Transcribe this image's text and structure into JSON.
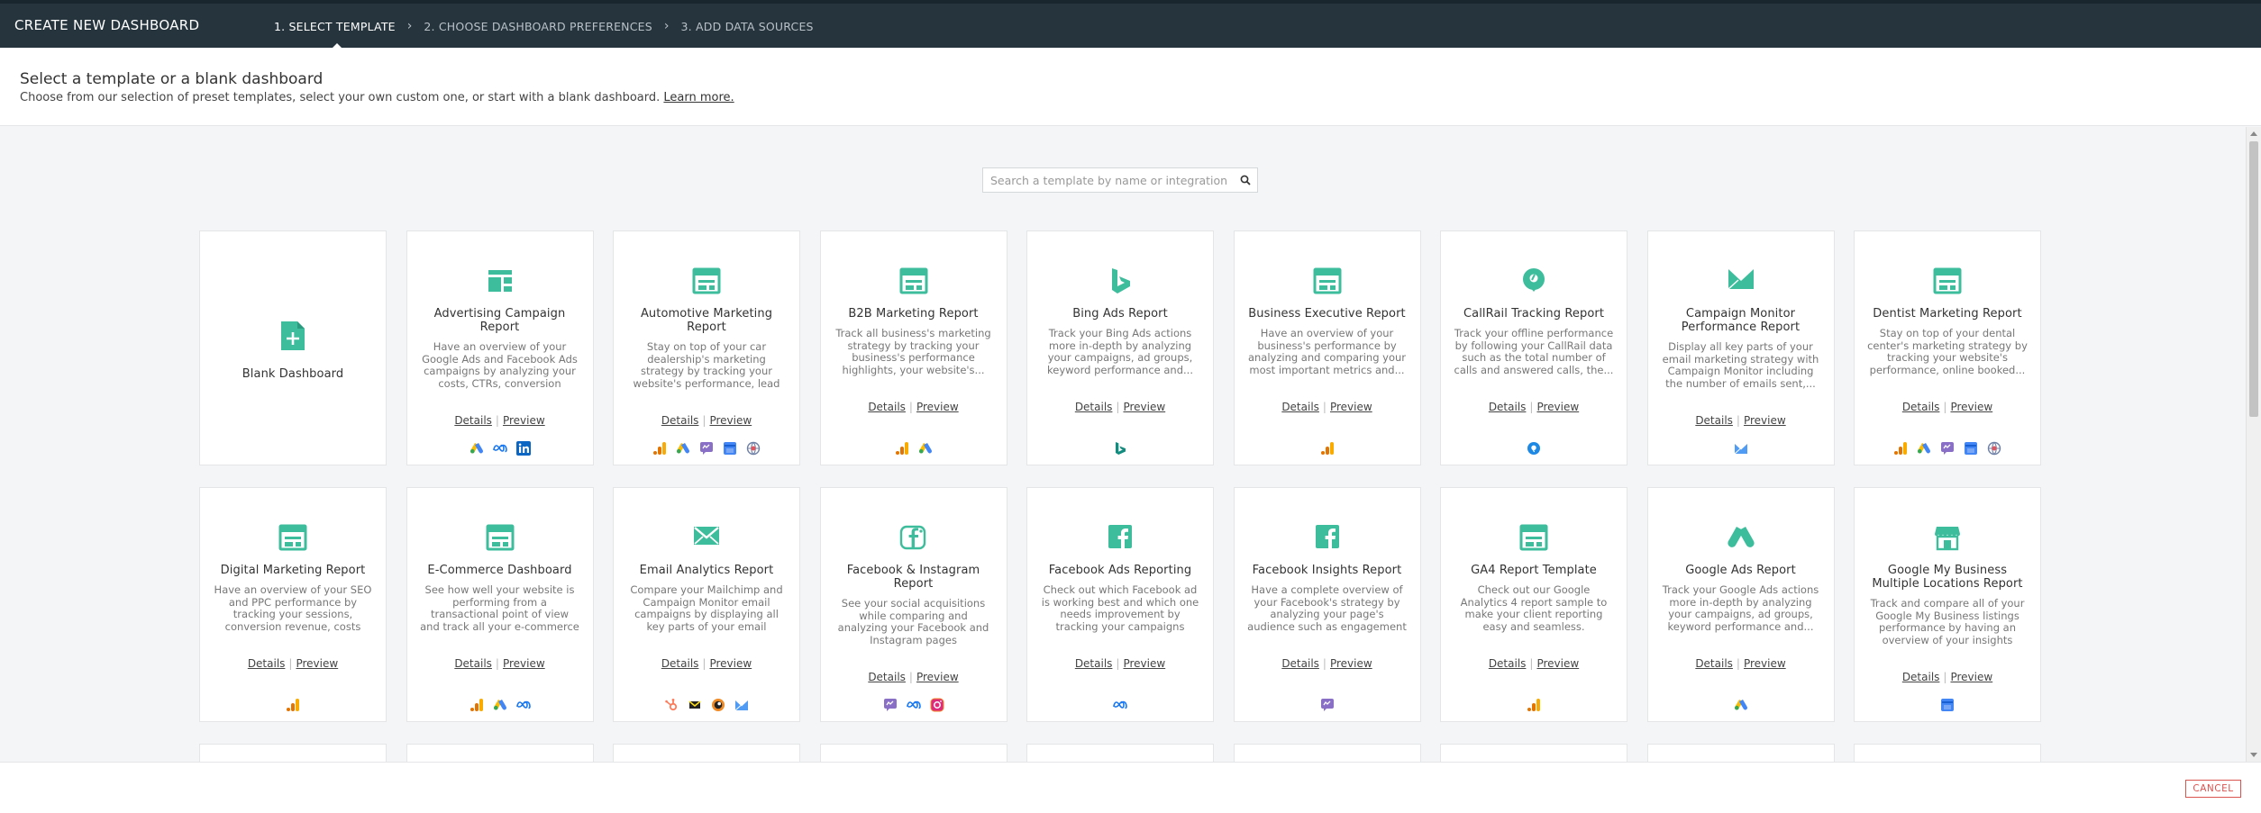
{
  "header": {
    "title": "CREATE NEW DASHBOARD",
    "steps": [
      "1. SELECT TEMPLATE",
      "2. CHOOSE DASHBOARD PREFERENCES",
      "3. ADD DATA SOURCES"
    ]
  },
  "intro": {
    "heading": "Select a template or a blank dashboard",
    "text": "Choose from our selection of preset templates, select your own custom one, or start with a blank dashboard.",
    "learn_more": "Learn more."
  },
  "search": {
    "placeholder": "Search a template by name or integration..."
  },
  "links": {
    "details": "Details",
    "preview": "Preview"
  },
  "blank_label": "Blank Dashboard",
  "templates": [
    {
      "name": "Advertising Campaign Report",
      "desc": "Have an overview of your Google Ads and Facebook Ads campaigns by analyzing your costs, CTRs, conversion rates...",
      "icon": "dashboard-icon",
      "integrations": [
        "google-ads-icon",
        "meta-icon",
        "linkedin-icon"
      ]
    },
    {
      "name": "Automotive Marketing Report",
      "desc": "Stay on top of your car dealership's marketing strategy by tracking your website's performance, lead acquisition...",
      "icon": "template-icon",
      "integrations": [
        "google-analytics-icon",
        "google-ads-icon",
        "chat-icon",
        "gmb-icon",
        "globe-icon"
      ]
    },
    {
      "name": "B2B Marketing Report",
      "desc": "Track all business's marketing strategy by tracking your business's performance highlights, your website's...",
      "icon": "template-icon",
      "integrations": [
        "google-analytics-icon",
        "google-ads-icon"
      ]
    },
    {
      "name": "Bing Ads Report",
      "desc": "Track your Bing Ads actions more in-depth by analyzing your campaigns, ad groups, keyword performance and...",
      "icon": "bing-icon",
      "integrations": [
        "bing-icon"
      ]
    },
    {
      "name": "Business Executive Report",
      "desc": "Have an overview of your business's performance by analyzing and comparing your most important metrics and...",
      "icon": "template-icon",
      "integrations": [
        "google-analytics-icon"
      ]
    },
    {
      "name": "CallRail Tracking Report",
      "desc": "Track your offline performance by following your CallRail data such as the total number of calls and answered calls, the...",
      "icon": "callrail-icon",
      "integrations": [
        "callrail-icon"
      ]
    },
    {
      "name": "Campaign Monitor Performance Report",
      "desc": "Display all key parts of your email marketing strategy with Campaign Monitor including the number of emails sent,...",
      "icon": "campaign-monitor-icon",
      "integrations": [
        "campaign-monitor-icon"
      ]
    },
    {
      "name": "Dentist Marketing Report",
      "desc": "Stay on top of your dental center's marketing strategy by tracking your website's performance, online booked...",
      "icon": "template-icon",
      "integrations": [
        "google-analytics-icon",
        "google-ads-icon",
        "chat-icon",
        "gmb-icon",
        "globe-icon"
      ]
    },
    {
      "name": "Digital Marketing Report",
      "desc": "Have an overview of your SEO and PPC performance by tracking your sessions, conversion revenue, costs and...",
      "icon": "template-icon",
      "integrations": [
        "google-analytics-icon"
      ]
    },
    {
      "name": "E-Commerce Dashboard",
      "desc": "See how well your website is performing from a transactional point of view and track all your e-commerce dat...",
      "icon": "template-icon",
      "integrations": [
        "google-analytics-icon",
        "google-ads-icon",
        "meta-icon"
      ]
    },
    {
      "name": "Email Analytics Report",
      "desc": "Compare your Mailchimp and Campaign Monitor email campaigns by displaying all key parts of your email marketing...",
      "icon": "email-icon",
      "integrations": [
        "hubspot-icon",
        "mailchimp-icon",
        "circle-icon",
        "campaign-monitor-icon"
      ]
    },
    {
      "name": "Facebook & Instagram Report",
      "desc": "See your social acquisitions while comparing and analyzing your Facebook and Instagram pages performances such as...",
      "icon": "facebook-instagram-icon",
      "integrations": [
        "chat-icon",
        "meta-icon",
        "instagram-icon"
      ]
    },
    {
      "name": "Facebook Ads Reporting",
      "desc": "Check out which Facebook ad is working best and which one needs improvement by tracking your campaigns performance...",
      "icon": "facebook-icon",
      "integrations": [
        "meta-icon"
      ]
    },
    {
      "name": "Facebook Insights Report",
      "desc": "Have a complete overview of your Facebook's strategy by analyzing your page's audience such as engagement rates,...",
      "icon": "facebook-icon",
      "integrations": [
        "chat-icon"
      ]
    },
    {
      "name": "GA4 Report Template",
      "desc": "Check out our Google Analytics 4 report sample to make your client reporting easy and seamless.",
      "icon": "template-icon",
      "integrations": [
        "google-analytics-icon"
      ]
    },
    {
      "name": "Google Ads Report",
      "desc": "Track your Google Ads actions more in-depth by analyzing your campaigns, ad groups, keyword performance and...",
      "icon": "google-ads-icon",
      "integrations": [
        "google-ads-icon"
      ]
    },
    {
      "name": "Google My Business Multiple Locations Report",
      "desc": "Track and compare all of your Google My Business listings performance by having an overview of your insights such...",
      "icon": "store-icon",
      "integrations": [
        "gmb-icon"
      ]
    }
  ],
  "footer": {
    "cancel": "CANCEL"
  },
  "colors": {
    "accent": "#3dbd9c",
    "header_bg": "#26343d",
    "cancel": "#d9534f"
  }
}
